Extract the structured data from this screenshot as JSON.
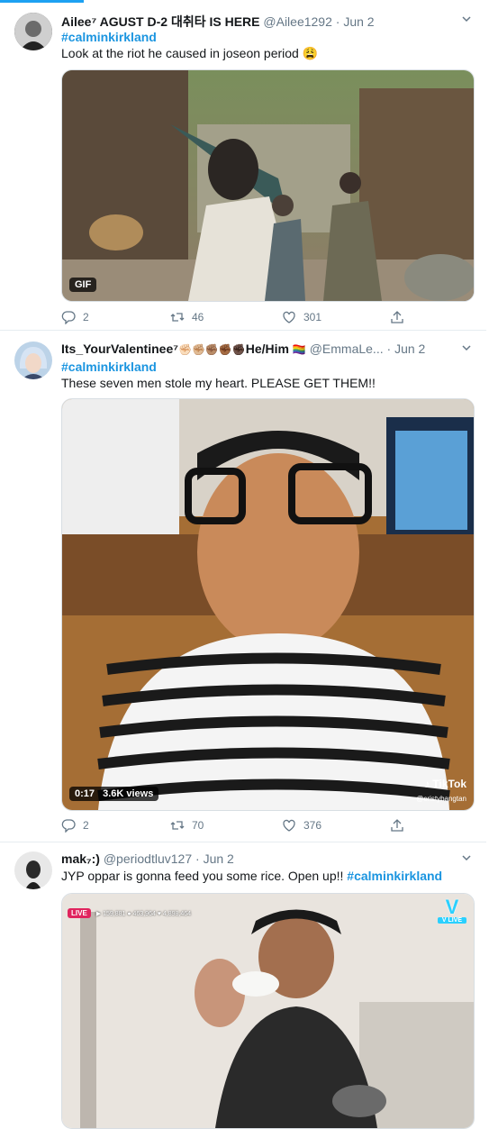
{
  "tweets": [
    {
      "name": "Ailee⁷ AGUST D-2 대취타 IS HERE",
      "handle": "@Ailee1292",
      "dot": "·",
      "date": "Jun 2",
      "hashtag": "#calminkirkland",
      "text": "Look at the riot he caused in joseon period",
      "text_emoji": "😩",
      "media_badge": "GIF",
      "replies": "2",
      "retweets": "46",
      "likes": "301"
    },
    {
      "name": "Its_YourValentinee⁷",
      "name_emoji": "✊🏻✊🏼✊🏽✊🏾✊🏿",
      "name_suffix": "He/Him",
      "flag": "🏳️‍🌈",
      "handle": "@EmmaLe...",
      "dot": "·",
      "date": "Jun 2",
      "hashtag": "#calminkirkland",
      "text": "These seven men stole my heart. PLEASE GET THEM!!",
      "video_time": "0:17",
      "video_views": "3.6K views",
      "watermark": "TikTok",
      "watermark_user": "@cristybangtan",
      "replies": "2",
      "retweets": "70",
      "likes": "376"
    },
    {
      "name": "mak₇:)",
      "handle": "@periodtluv127",
      "dot": "·",
      "date": "Jun 2",
      "text": "JYP oppar is gonna feed you some rice. Open up!! ",
      "hashtag": "#calminkirkland",
      "live_label": "LIVE",
      "live_stats": "▶ 159,881  ● 463,964  ♥ 4,898,464",
      "vlive_label": "V LIVE"
    }
  ],
  "colors": {
    "accent": "#1da1f2",
    "link": "#1b95e0",
    "muted": "#657786",
    "border": "#e6ecf0"
  },
  "icons": [
    "reply-icon",
    "retweet-icon",
    "like-icon",
    "share-icon",
    "chevron-down-icon"
  ]
}
